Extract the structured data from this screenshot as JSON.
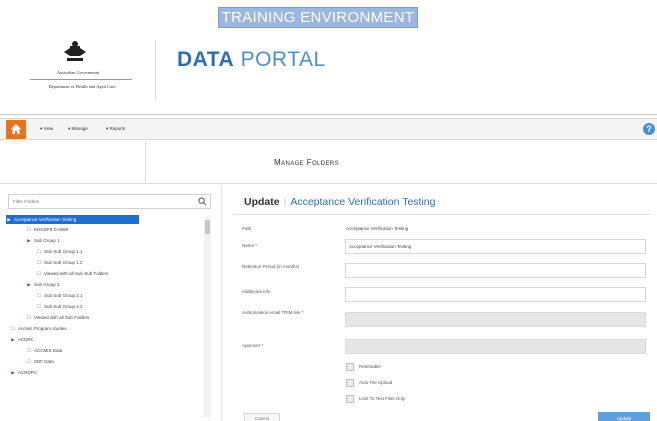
{
  "banner": {
    "text": "TRAINING ENVIRONMENT"
  },
  "header": {
    "gov_name": "Australian Government",
    "department": "Department of Health and Aged Care",
    "portal_bold": "DATA",
    "portal_light": "PORTAL"
  },
  "nav": {
    "items": [
      "▾ View",
      "▾ Manage",
      "▾ Reports"
    ],
    "help": "?"
  },
  "page": {
    "title": "Manage Folders"
  },
  "sidebar": {
    "filter_placeholder": "Filter Folders",
    "tree": [
      {
        "label": "Acceptance Verification Testing",
        "icon": "folder-icon",
        "selected": true
      },
      {
        "label": "EDGDF8 D-5080",
        "icon": "document-icon"
      },
      {
        "label": "Sub Group 1",
        "icon": "folder-icon"
      },
      {
        "label": "Sub Sub Group 1.1",
        "icon": "document-icon"
      },
      {
        "label": "Sub Sub Group 1.2",
        "icon": "document-icon"
      },
      {
        "label": "Viewed with all Sub Sub Folders",
        "icon": "document-icon"
      },
      {
        "label": "Sub Group 2",
        "icon": "folder-icon"
      },
      {
        "label": "Sub Sub Group 2.1",
        "icon": "document-icon"
      },
      {
        "label": "Sub Sub Group 2.2",
        "icon": "document-icon"
      },
      {
        "label": "Viewed with all Sub Folders",
        "icon": "document-icon"
      },
      {
        "label": "Access Program studies",
        "icon": "document-icon"
      },
      {
        "label": "ACDRC",
        "icon": "folder-icon"
      },
      {
        "label": "ACCMIS Data",
        "icon": "document-icon"
      },
      {
        "label": "SDF Data",
        "icon": "document-icon"
      },
      {
        "label": "ACRDPC",
        "icon": "folder-icon"
      }
    ]
  },
  "form": {
    "header_bold": "Update",
    "header_name": "Acceptance Verification Testing",
    "path_label": "Path",
    "path_value": "Acceptance Verification Testing",
    "name_label": "Name *",
    "name_value": "Acceptance Verification Testing",
    "retention_label": "Retention Period (in months)",
    "retention_value": "",
    "additional_label": "Additional Info",
    "additional_value": "",
    "authorisation_label": "Authorisation email TRIM link *",
    "authorisation_value": "",
    "approver_label": "Approver *",
    "approver_value": "",
    "checkboxes": [
      "Retentable",
      "Auto File Upload",
      "Limit To Text Files Only"
    ],
    "cancel_label": "Cancel",
    "update_label": "Update"
  },
  "colors": {
    "accent_blue": "#2e6fb3",
    "selected_bg": "#1f6fcf",
    "home_orange": "#e8731c",
    "banner_bg": "#9ab6e1",
    "update_button": "#5f9fde"
  }
}
